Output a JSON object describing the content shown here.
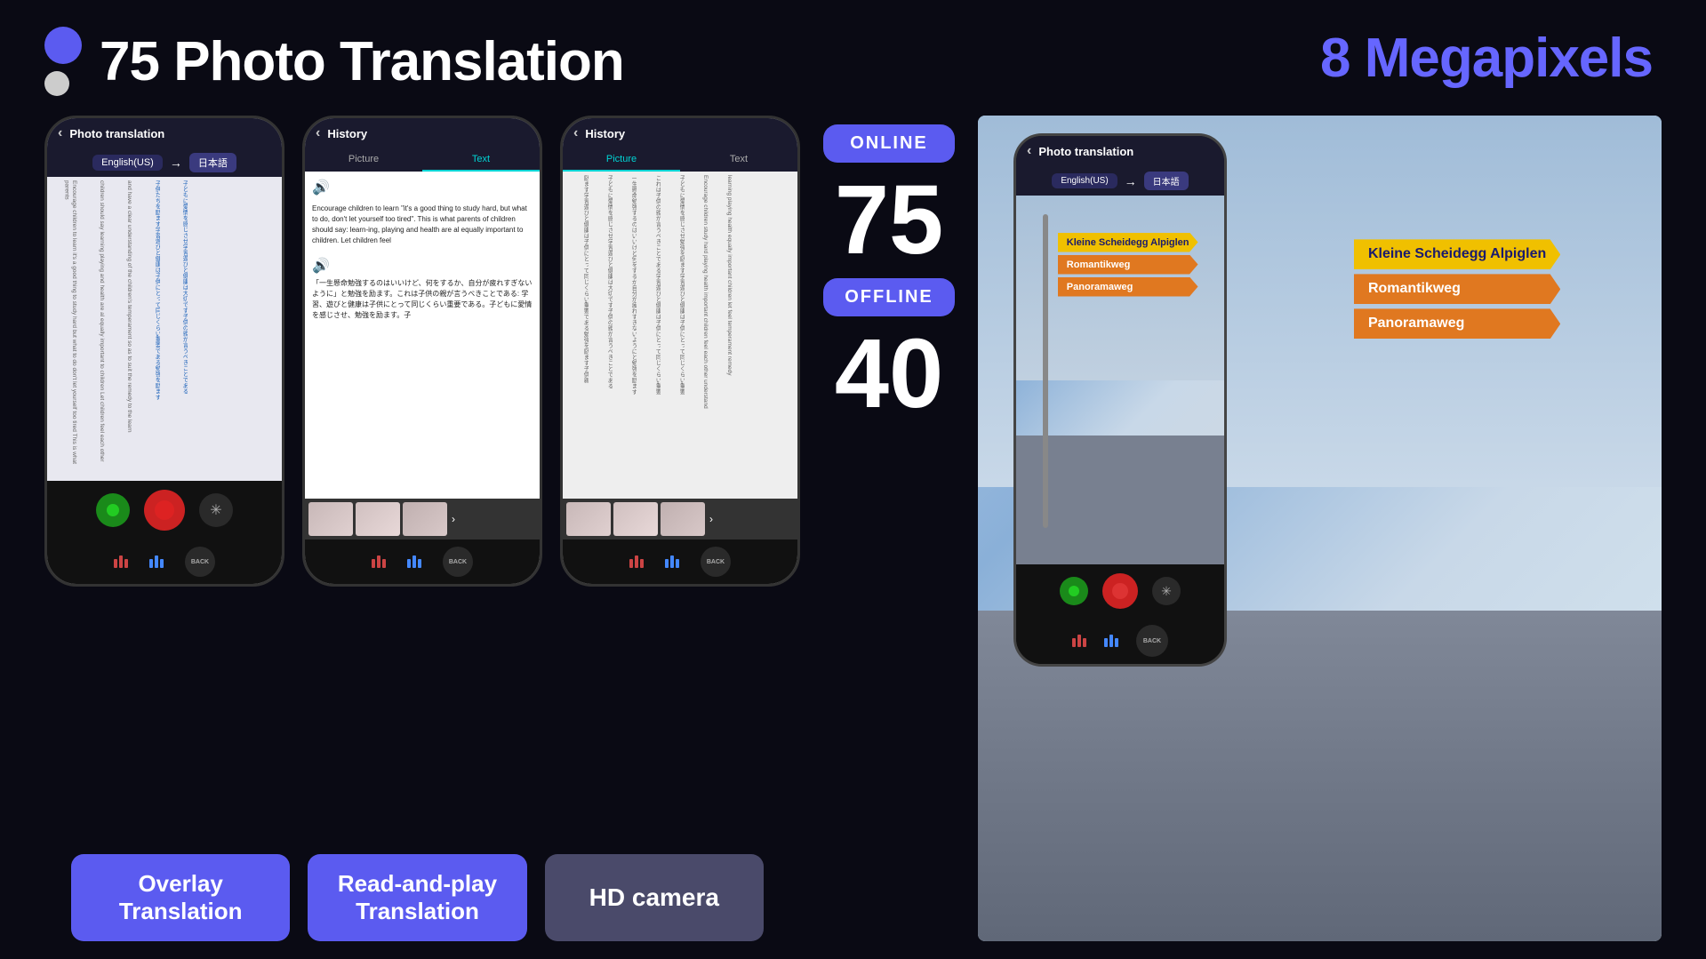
{
  "header": {
    "title": "75 Photo Translation",
    "megapixels": "8 Megapixels",
    "dot_blue": "●",
    "dot_white": "○"
  },
  "phone1": {
    "topbar": "Photo translation",
    "lang_from": "English(US)",
    "lang_to": "日本語",
    "text_content": "Encourage children to learn 'it's a good thing to study hard, but what to do, don't let yourself too tired'. This is what parents of children should say: learning, playing and health are al equally important to children. Let children feel each other and have a clear understanding of the children's temperament so as to suit the remedy to the",
    "overlay_text": "子供たちを励ます。学習、遊びと健康は子供にとって同じくらい重要である。"
  },
  "phone2": {
    "topbar": "History",
    "tab_picture": "Picture",
    "tab_text": "Text",
    "active_tab": "Text",
    "text_en": "Encourage children to learn \"it's a good thing to study hard, but what to do, don't let yourself too tired\". This is what parents of children should say: learn-ing, playing and health are al equally important to children. Let children feel",
    "text_jp": "「一生懸命勉強するのはいいけど、何をするか、自分が疲れすぎないように」と勉強を励ます。これは子供の親が言うべきことである: 学習、遊びと健康は子供にとって同じくらい重要である。子どもに愛情を感じさせ、勉強を励ます。子"
  },
  "phone3": {
    "topbar": "History",
    "tab_picture": "Picture",
    "tab_text": "Text",
    "active_tab": "Picture"
  },
  "stats": {
    "online_label": "ONLINE",
    "online_number": "75",
    "offline_label": "OFFLINE",
    "offline_number": "40"
  },
  "big_phone": {
    "topbar": "Photo translation",
    "lang_from": "English(US)",
    "lang_to": "日本語",
    "sign1": "Kleine Scheidegg Alpiglen",
    "sign2": "Romantikweg",
    "sign3": "Panoramaweg"
  },
  "captions": {
    "overlay": "Overlay\nTranslation",
    "read_play": "Read-and-play\nTranslation",
    "hd_camera": "HD camera"
  },
  "controls": {
    "back": "BACK"
  }
}
